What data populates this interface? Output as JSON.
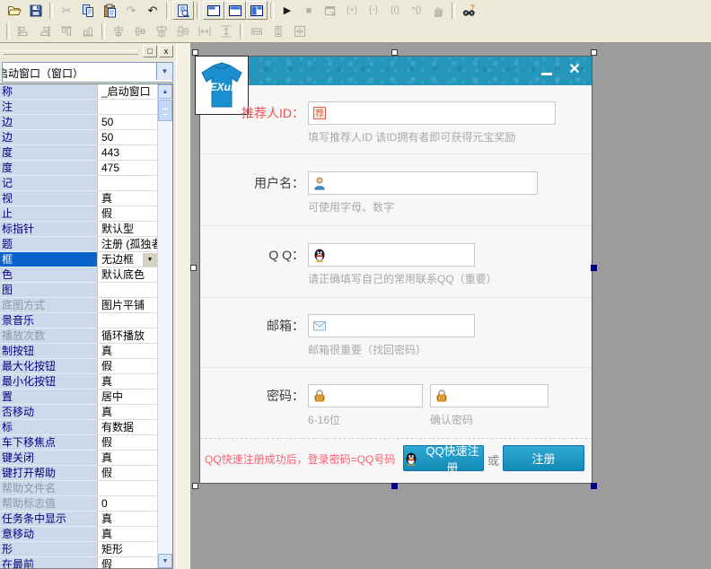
{
  "toolbar": {
    "row1": [
      {
        "icon": "open",
        "name": "open-button",
        "enabled": true
      },
      {
        "icon": "save",
        "name": "save-button",
        "enabled": true
      },
      {
        "sep": true
      },
      {
        "icon": "cut",
        "name": "cut-button",
        "enabled": false
      },
      {
        "icon": "copy",
        "name": "copy-button",
        "enabled": true
      },
      {
        "icon": "paste",
        "name": "paste-button",
        "enabled": true
      },
      {
        "icon": "redo",
        "name": "redo-button",
        "enabled": false
      },
      {
        "icon": "undo",
        "name": "undo-button",
        "enabled": true
      },
      {
        "sep": true
      },
      {
        "icon": "code-view",
        "name": "view-code-button",
        "enabled": true,
        "framed": true
      },
      {
        "sep": true
      },
      {
        "icon": "layout-1",
        "name": "layout-toggle-1-button",
        "enabled": true,
        "framed": true
      },
      {
        "icon": "layout-2",
        "name": "layout-toggle-2-button",
        "enabled": true,
        "framed": true
      },
      {
        "icon": "layout-3",
        "name": "layout-toggle-3-button",
        "enabled": true,
        "framed": true
      },
      {
        "sep": true
      },
      {
        "icon": "run",
        "name": "run-button",
        "enabled": true
      },
      {
        "icon": "stop",
        "name": "stop-button",
        "enabled": false
      },
      {
        "icon": "debug-window",
        "name": "debug-button",
        "enabled": false
      },
      {
        "icon": "brace-1",
        "name": "step-into-button",
        "enabled": false
      },
      {
        "icon": "brace-2",
        "name": "step-over-button",
        "enabled": false
      },
      {
        "icon": "brace-3",
        "name": "step-out-button",
        "enabled": false
      },
      {
        "icon": "brace-4",
        "name": "run-to-cursor-button",
        "enabled": false
      },
      {
        "icon": "hand",
        "name": "pause-button",
        "enabled": false
      },
      {
        "sep": true
      },
      {
        "icon": "find",
        "name": "find-button",
        "enabled": true
      }
    ],
    "row2": [
      {
        "sep": true
      },
      {
        "icon": "align-left",
        "name": "align-left-button",
        "enabled": false
      },
      {
        "icon": "align-right",
        "name": "align-right-button",
        "enabled": false
      },
      {
        "icon": "align-top",
        "name": "align-top-button",
        "enabled": false
      },
      {
        "icon": "align-bottom",
        "name": "align-bottom-button",
        "enabled": false
      },
      {
        "sep": true
      },
      {
        "icon": "center-h",
        "name": "center-horizontal-button",
        "enabled": false
      },
      {
        "icon": "center-v",
        "name": "center-vertical-button",
        "enabled": false
      },
      {
        "icon": "middle-h",
        "name": "align-middles-h-button",
        "enabled": false
      },
      {
        "icon": "middle-v",
        "name": "align-middles-v-button",
        "enabled": false
      },
      {
        "icon": "space-h",
        "name": "space-evenly-h-button",
        "enabled": false
      },
      {
        "icon": "space-v",
        "name": "space-evenly-v-button",
        "enabled": false
      },
      {
        "sep": true
      },
      {
        "icon": "same-w",
        "name": "make-same-width-button",
        "enabled": false
      },
      {
        "icon": "same-h",
        "name": "make-same-height-button",
        "enabled": false
      },
      {
        "icon": "same-size",
        "name": "make-same-size-button",
        "enabled": false
      }
    ]
  },
  "property_panel": {
    "titlebar": {
      "maximize_glyph": "□",
      "close_glyph": "x"
    },
    "selector_value": "启动窗口（窗口）",
    "rows": [
      {
        "n": "称",
        "v": "_启动窗口"
      },
      {
        "n": "注",
        "v": ""
      },
      {
        "n": "边",
        "v": "50"
      },
      {
        "n": "边",
        "v": "50"
      },
      {
        "n": "度",
        "v": "443"
      },
      {
        "n": "度",
        "v": "475"
      },
      {
        "n": "记",
        "v": ""
      },
      {
        "n": "视",
        "v": "真"
      },
      {
        "n": "止",
        "v": "假"
      },
      {
        "n": "标指针",
        "v": "默认型"
      },
      {
        "n": "题",
        "v": "注册 (孤独者传播者"
      },
      {
        "n": "框",
        "v": "无边框",
        "selected": true,
        "dropdown": true
      },
      {
        "n": "色",
        "v": "默认底色"
      },
      {
        "n": "图",
        "v": ""
      },
      {
        "n": "底图方式",
        "v": "图片平铺",
        "dim": true
      },
      {
        "n": "景音乐",
        "v": ""
      },
      {
        "n": "播放次数",
        "v": "循环播放",
        "dim": true
      },
      {
        "n": "制按钮",
        "v": "真"
      },
      {
        "n": "最大化按钮",
        "v": "假"
      },
      {
        "n": "最小化按钮",
        "v": "真"
      },
      {
        "n": "置",
        "v": "居中"
      },
      {
        "n": "否移动",
        "v": "真"
      },
      {
        "n": "标",
        "v": "有数据"
      },
      {
        "n": "车下移焦点",
        "v": "假"
      },
      {
        "n": "键关闭",
        "v": "真"
      },
      {
        "n": "键打开帮助",
        "v": "假"
      },
      {
        "n": "帮助文件名",
        "v": "",
        "dim": true
      },
      {
        "n": "帮助标志值",
        "v": "0",
        "dim": true
      },
      {
        "n": "任务条中显示",
        "v": "真"
      },
      {
        "n": "意移动",
        "v": "真"
      },
      {
        "n": "形",
        "v": "矩形"
      },
      {
        "n": "在最前",
        "v": "假"
      }
    ]
  },
  "dialog": {
    "logo_text": "EXui",
    "fields": [
      {
        "id": "referrer",
        "label": "推荐人ID：",
        "label_red": true,
        "icon": "badge-icon",
        "hint": "填写推荐人ID 该ID拥有者即可获得元宝奖励"
      },
      {
        "id": "username",
        "label": "用户名：",
        "icon": "user-icon",
        "hint": "可使用字母、数字"
      },
      {
        "id": "qq",
        "label": "Q Q：",
        "icon": "qq-icon",
        "hint": "请正确填写自己的常用联系QQ（重要）"
      },
      {
        "id": "email",
        "label": "邮箱：",
        "icon": "mail-icon",
        "hint": "邮箱很重要（找回密码）"
      },
      {
        "id": "password",
        "label": "密码：",
        "icon": "lock-icon",
        "hint": "6-16位",
        "hint2": "确认密码"
      }
    ],
    "footer": {
      "note": "QQ快速注册成功后，登录密码=QQ号码",
      "qq_button": "QQ快速注册",
      "or_label": "或",
      "register_button": "注册"
    },
    "colors": {
      "titlebar": "#2396ba",
      "button": "#1c9cc9",
      "red_label": "#f24f4f",
      "pink_note": "#ff5f72",
      "selected_row": "#0a62cc"
    }
  }
}
